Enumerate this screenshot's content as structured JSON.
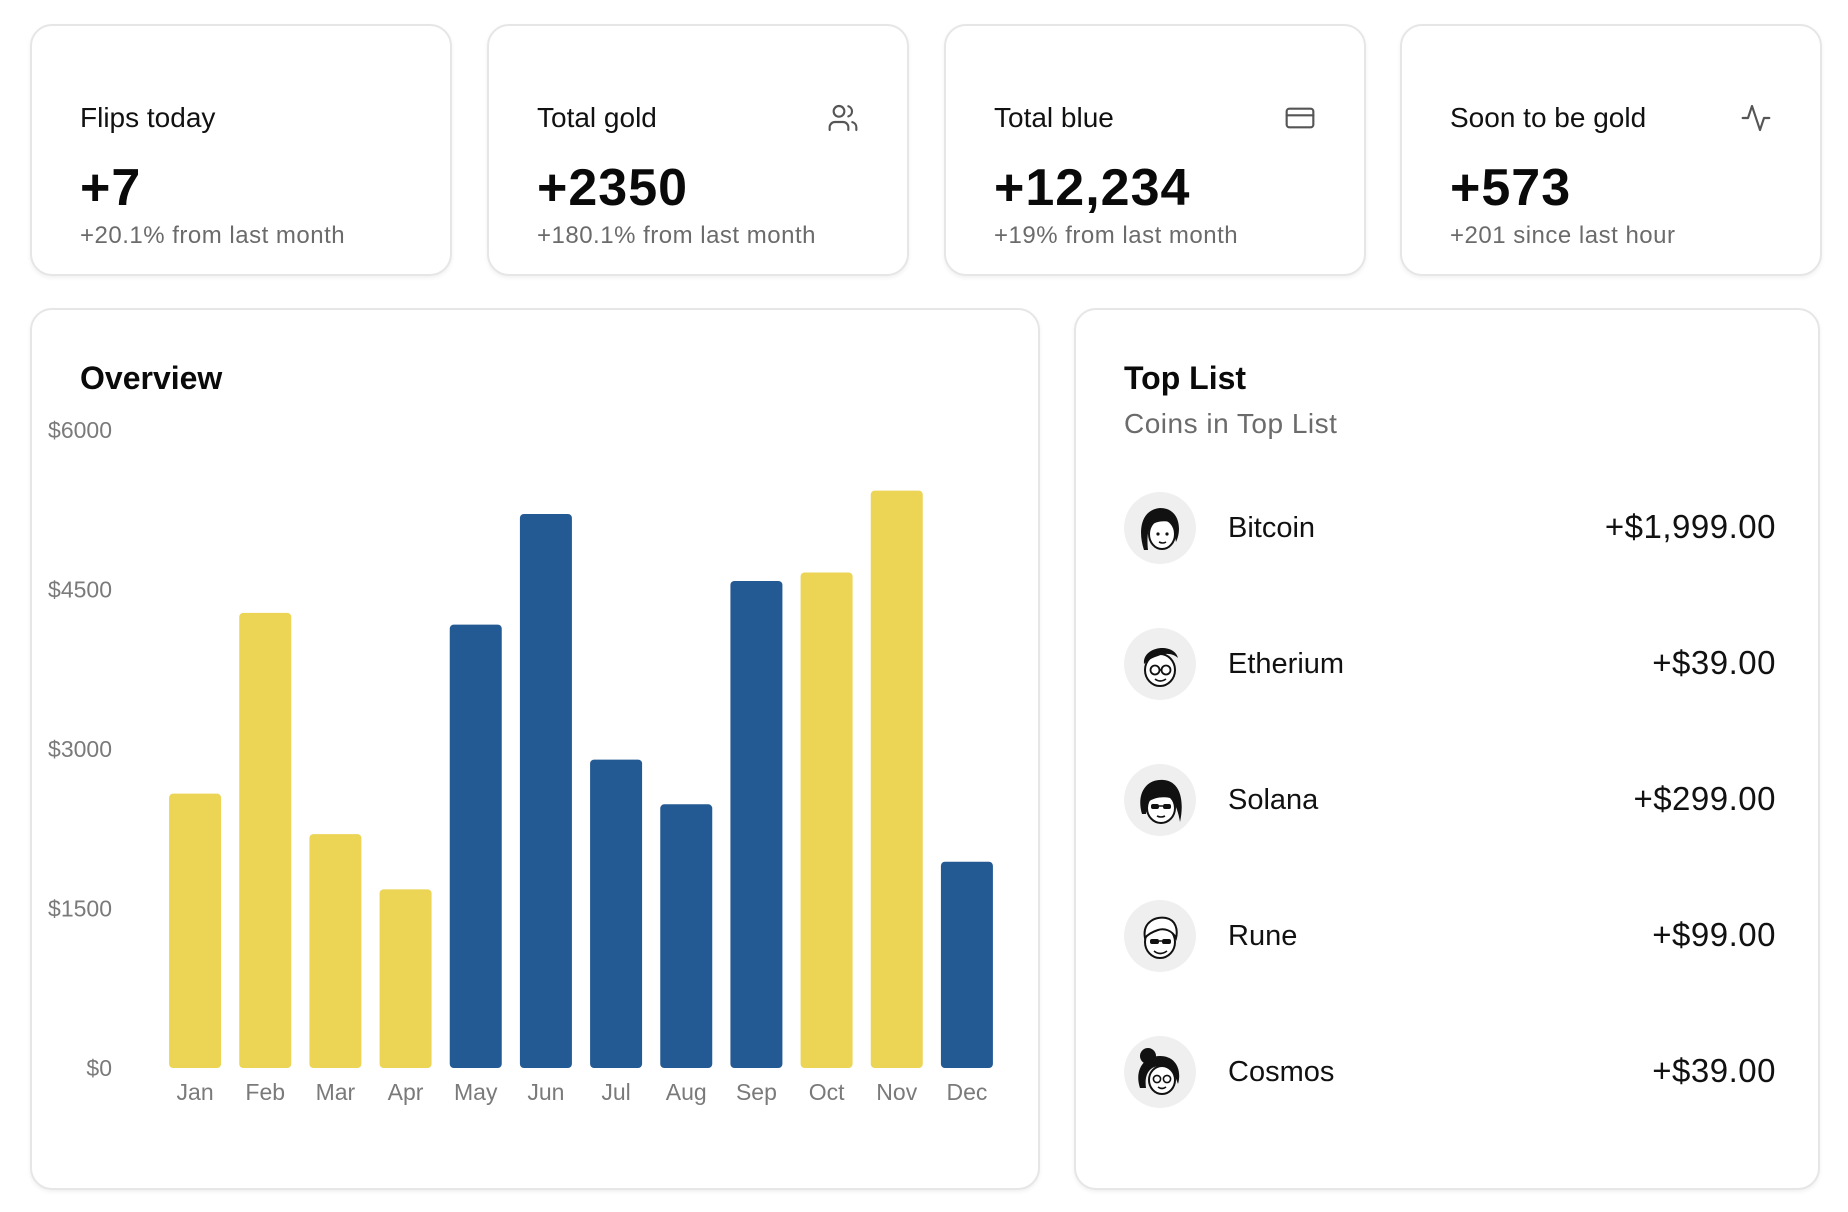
{
  "stats": [
    {
      "label": "Flips today",
      "value": "+7",
      "sub": "+20.1% from last month",
      "icon": ""
    },
    {
      "label": "Total gold",
      "value": "+2350",
      "sub": "+180.1% from last month",
      "icon": "users-icon"
    },
    {
      "label": "Total blue",
      "value": "+12,234",
      "sub": "+19% from last month",
      "icon": "credit-card-icon"
    },
    {
      "label": "Soon to be gold",
      "value": "+573",
      "sub": "+201 since last hour",
      "icon": "activity-icon"
    }
  ],
  "overview": {
    "title": "Overview"
  },
  "chart_data": {
    "type": "bar",
    "title": "Overview",
    "categories": [
      "Jan",
      "Feb",
      "Mar",
      "Apr",
      "May",
      "Jun",
      "Jul",
      "Aug",
      "Sep",
      "Oct",
      "Nov",
      "Dec"
    ],
    "values": [
      2580,
      4280,
      2200,
      1680,
      4170,
      5210,
      2900,
      2480,
      4580,
      4660,
      5430,
      1940
    ],
    "bar_colors": [
      "#ecd455",
      "#ecd455",
      "#ecd455",
      "#ecd455",
      "#245a94",
      "#245a94",
      "#245a94",
      "#245a94",
      "#245a94",
      "#ecd455",
      "#ecd455",
      "#245a94"
    ],
    "y_ticks": [
      "$0",
      "$1500",
      "$3000",
      "$4500",
      "$6000"
    ],
    "ylim": [
      0,
      6000
    ],
    "grid": false,
    "xlabel": "",
    "ylabel": ""
  },
  "toplist": {
    "title": "Top List",
    "subtitle": "Coins in Top List",
    "items": [
      {
        "name": "Bitcoin",
        "amount": "+$1,999.00",
        "avatar": "avatar-long-hair-icon"
      },
      {
        "name": "Etherium",
        "amount": "+$39.00",
        "avatar": "avatar-glasses-icon"
      },
      {
        "name": "Solana",
        "amount": "+$299.00",
        "avatar": "avatar-sunglasses-icon"
      },
      {
        "name": "Rune",
        "amount": "+$99.00",
        "avatar": "avatar-sunglasses-short-icon"
      },
      {
        "name": "Cosmos",
        "amount": "+$39.00",
        "avatar": "avatar-bun-icon"
      }
    ]
  }
}
